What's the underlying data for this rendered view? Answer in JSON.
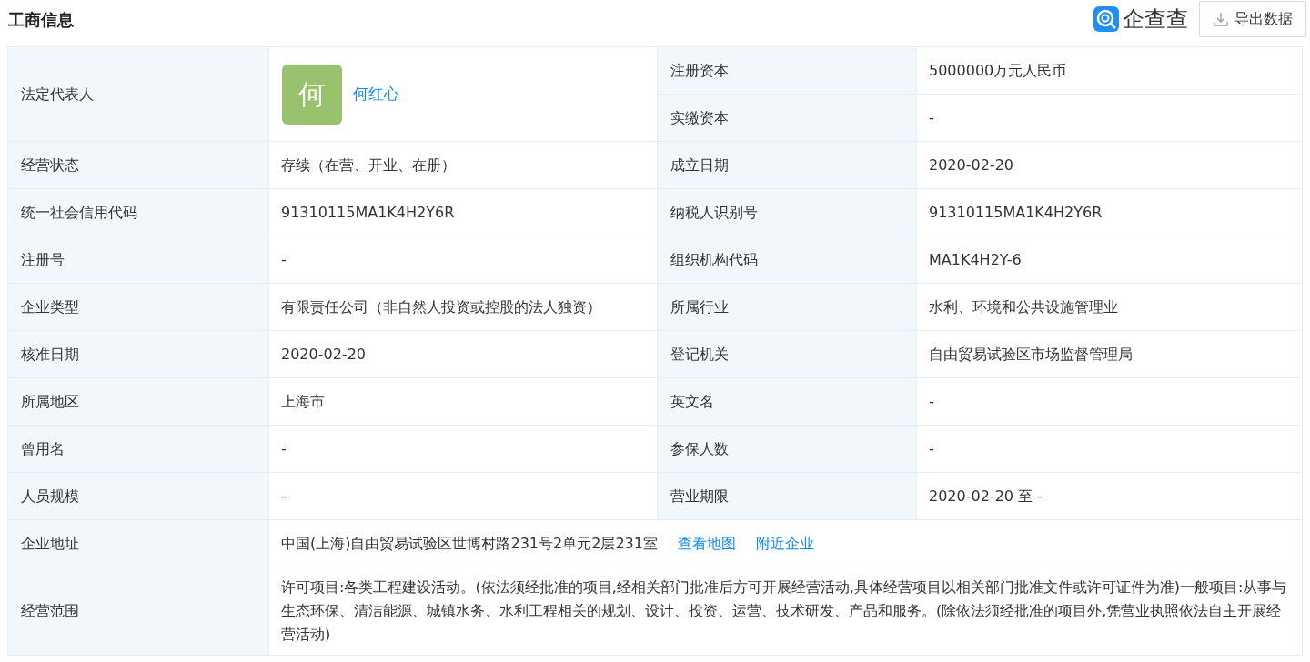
{
  "header": {
    "title": "工商信息",
    "brand": "企查查",
    "export_button": "导出数据"
  },
  "legal_rep": {
    "label": "法定代表人",
    "avatar": "何",
    "name": "何红心",
    "right": [
      {
        "label": "注册资本",
        "value": "5000000万元人民币"
      },
      {
        "label": "实缴资本",
        "value": "-"
      }
    ]
  },
  "rows": [
    {
      "left_label": "经营状态",
      "left_value": "存续（在营、开业、在册）",
      "right_label": "成立日期",
      "right_value": "2020-02-20"
    },
    {
      "left_label": "统一社会信用代码",
      "left_value": "91310115MA1K4H2Y6R",
      "right_label": "纳税人识别号",
      "right_value": "91310115MA1K4H2Y6R"
    },
    {
      "left_label": "注册号",
      "left_value": "-",
      "right_label": "组织机构代码",
      "right_value": "MA1K4H2Y-6"
    },
    {
      "left_label": "企业类型",
      "left_value": "有限责任公司（非自然人投资或控股的法人独资）",
      "right_label": "所属行业",
      "right_value": "水利、环境和公共设施管理业"
    },
    {
      "left_label": "核准日期",
      "left_value": "2020-02-20",
      "right_label": "登记机关",
      "right_value": "自由贸易试验区市场监督管理局"
    },
    {
      "left_label": "所属地区",
      "left_value": "上海市",
      "right_label": "英文名",
      "right_value": "-"
    },
    {
      "left_label": "曾用名",
      "left_value": "-",
      "right_label": "参保人数",
      "right_value": "-"
    },
    {
      "left_label": "人员规模",
      "left_value": "-",
      "right_label": "营业期限",
      "right_value": "2020-02-20 至 -"
    }
  ],
  "address": {
    "label": "企业地址",
    "value": "中国(上海)自由贸易试验区世博村路231号2单元2层231室",
    "links": [
      "查看地图",
      "附近企业"
    ]
  },
  "scope": {
    "label": "经营范围",
    "value": "许可项目:各类工程建设活动。(依法须经批准的项目,经相关部门批准后方可开展经营活动,具体经营项目以相关部门批准文件或许可证件为准)一般项目:从事与生态环保、清洁能源、城镇水务、水利工程相关的规划、设计、投资、运营、技术研发、产品和服务。(除依法须经批准的项目外,凭营业执照依法自主开展经营活动)"
  }
}
